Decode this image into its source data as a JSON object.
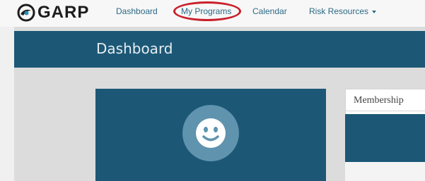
{
  "brand": {
    "name": "GARP"
  },
  "nav": {
    "items": [
      {
        "label": "Dashboard"
      },
      {
        "label": "My Programs"
      },
      {
        "label": "Calendar"
      },
      {
        "label": "Risk Resources"
      }
    ]
  },
  "header": {
    "title": "Dashboard"
  },
  "membership": {
    "title": "Membership"
  },
  "icons": {
    "logo": "garp-logo-icon",
    "avatar": "smiley-face-icon",
    "dropdown": "chevron-down-icon"
  },
  "colors": {
    "brand_blue": "#1c5876",
    "nav_link": "#2c6a85",
    "avatar_bg": "#5f93ae",
    "annotation_red": "#c9202b"
  }
}
